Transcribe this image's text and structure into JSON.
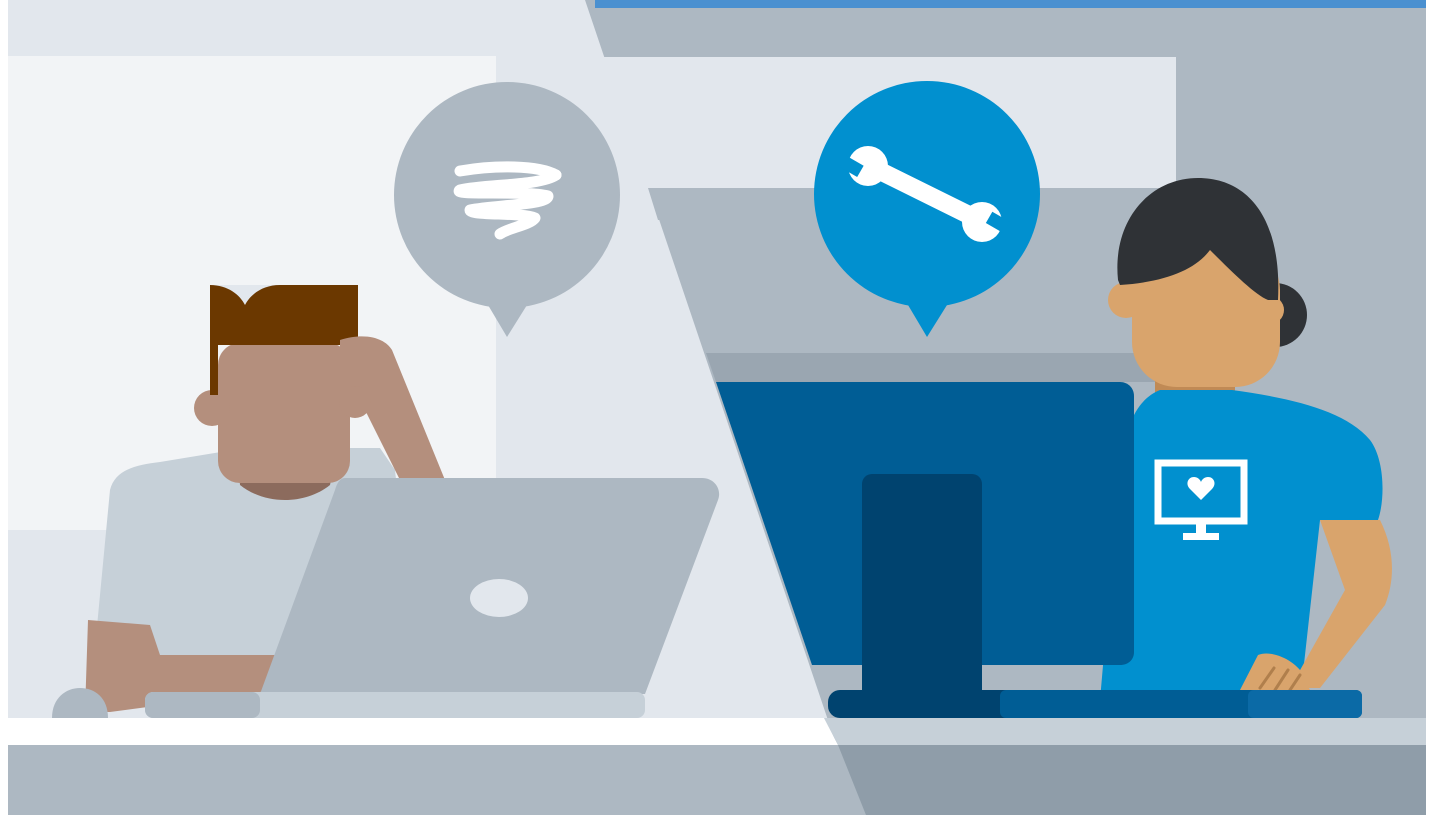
{
  "illustration": {
    "left_speech_bubble_icon": "scribble-icon",
    "right_speech_bubble_icon": "wrench-icon",
    "shirt_emblem_icon": "monitor-heart-icon"
  },
  "colors": {
    "wall_light": "#e2e7ed",
    "wall_gray": "#adb8c2",
    "window_panel": "#f2f4f6",
    "desk_top": "#ffffff",
    "desk_front": "#adb8c2",
    "brand_blue": "#0190cf",
    "monitor_blue": "#005d95",
    "monitor_stand_blue": "#00436f",
    "bubble_gray": "#adb8c2",
    "laptop_gray": "#adb8c2",
    "man_skin": "#b48f7d",
    "man_hair": "#6b3800",
    "man_shirt": "#c6d0d8",
    "woman_skin": "#d9a46c",
    "woman_hair": "#2f3236"
  }
}
